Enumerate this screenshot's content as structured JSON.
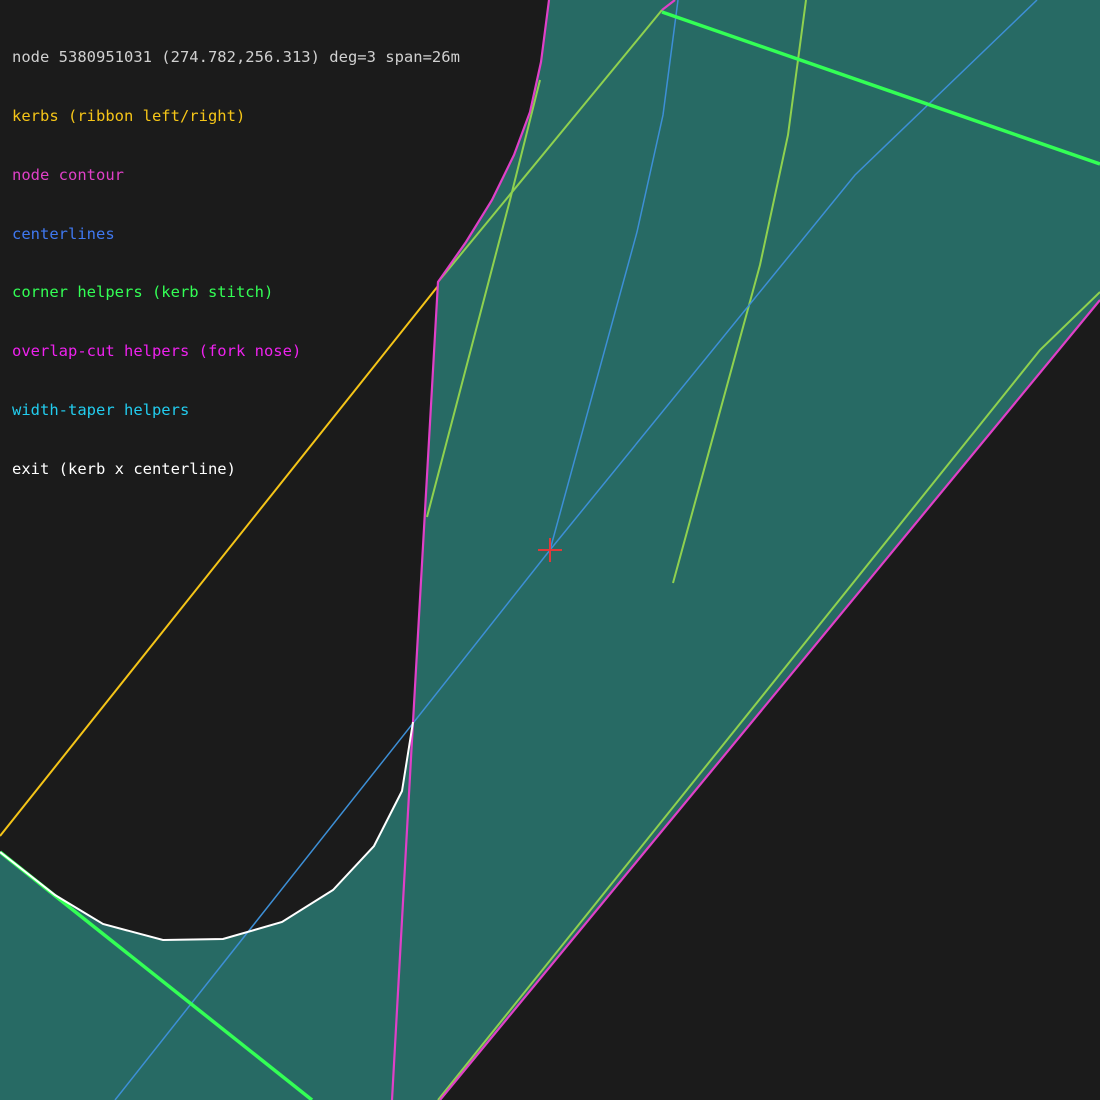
{
  "header": "node 5380951031 (274.782,256.313) deg=3 span=26m",
  "legend": [
    {
      "key": "kerbs",
      "label": "kerbs (ribbon left/right)",
      "color": "#f5c518"
    },
    {
      "key": "contour",
      "label": "node contour",
      "color": "#e040c8"
    },
    {
      "key": "centerlines",
      "label": "centerlines",
      "color": "#3f78f0"
    },
    {
      "key": "corner",
      "label": "corner helpers (kerb stitch)",
      "color": "#33ff55"
    },
    {
      "key": "overlap",
      "label": "overlap-cut helpers (fork nose)",
      "color": "#ee22ee"
    },
    {
      "key": "taper",
      "label": "width-taper helpers",
      "color": "#22ccee"
    },
    {
      "key": "exit",
      "label": "exit (kerb x centerline)",
      "color": "#ffffff"
    }
  ],
  "colors": {
    "background": "#1b1b1b",
    "surface": "#276a64",
    "header_text": "#d0d0d0",
    "taper_line": "#8fd14f",
    "node_marker": "#e03a3a"
  }
}
